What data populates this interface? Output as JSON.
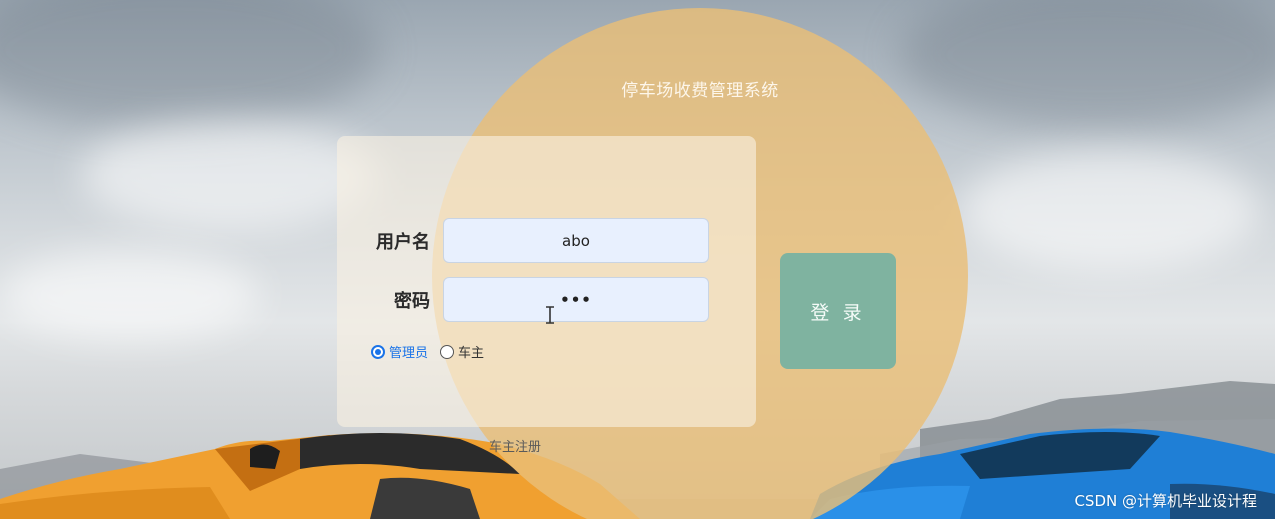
{
  "app": {
    "title": "停车场收费管理系统"
  },
  "login_form": {
    "username_label": "用户名",
    "username_value": "abo",
    "password_label": "密码",
    "password_value": "•••",
    "roles": [
      {
        "label": "管理员",
        "checked": true
      },
      {
        "label": "车主",
        "checked": false
      }
    ],
    "login_button": "登 录",
    "register_link": "车主注册"
  },
  "watermark": "CSDN @计算机毕业设计程",
  "colors": {
    "circle": "#e9be78",
    "login_button": "#7fb3a0",
    "radio_accent": "#1a73e8",
    "input_bg": "#e8f0fe"
  },
  "icons": {
    "cursor": "text-cursor-icon"
  }
}
